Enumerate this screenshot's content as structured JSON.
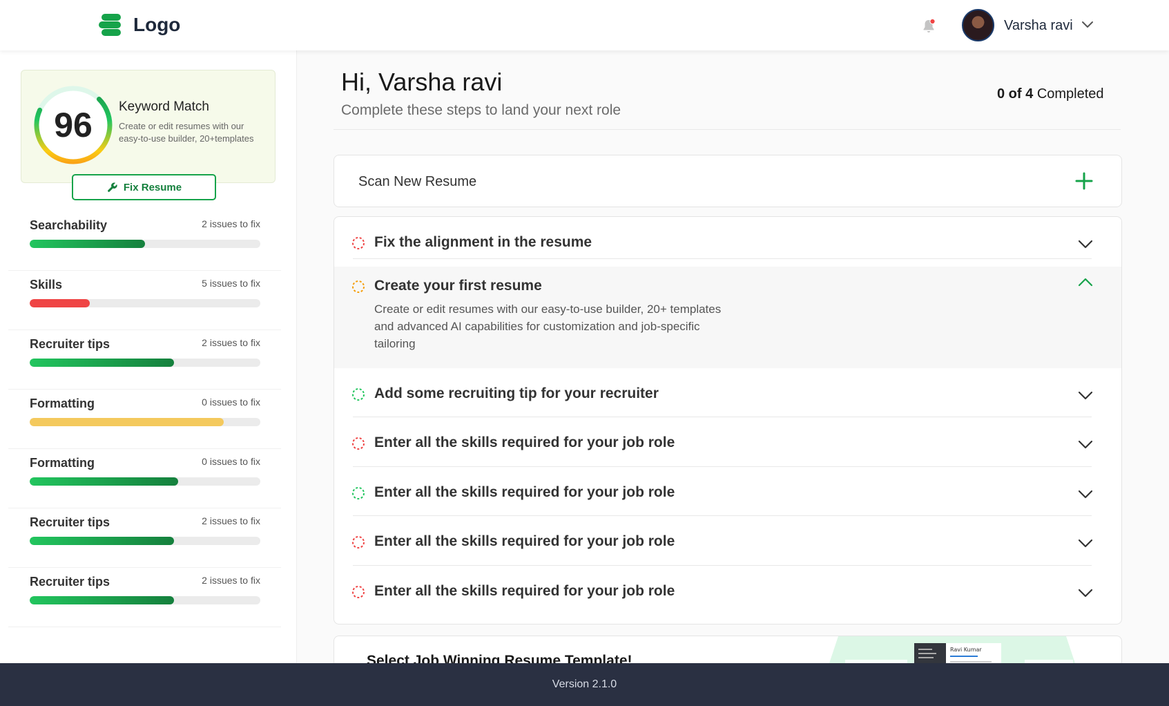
{
  "header": {
    "logo_text": "Logo",
    "user_name": "Varsha ravi"
  },
  "sidebar": {
    "keyword_match": {
      "score": "96",
      "score_value": 96,
      "title": "Keyword Match",
      "description": "Create or edit resumes with our easy-to-use builder, 20+templates"
    },
    "fix_button_label": "Fix Resume",
    "metrics": [
      {
        "label": "Searchability",
        "issues": "2 issues to fix",
        "progress": 0.5,
        "color": "#16a34a"
      },
      {
        "label": "Skills",
        "issues": "5 issues to fix",
        "progress": 0.26,
        "color": "#ef4444"
      },
      {
        "label": "Recruiter tips",
        "issues": "2 issues to fix",
        "progress": 0.625,
        "color": "#16a34a"
      },
      {
        "label": "Formatting",
        "issues": "0 issues to fix",
        "progress": 0.84,
        "color": "#f4c95d"
      },
      {
        "label": "Formatting",
        "issues": "0 issues to fix",
        "progress": 0.645,
        "color": "#16a34a"
      },
      {
        "label": "Recruiter tips",
        "issues": "2 issues to fix",
        "progress": 0.625,
        "color": "#16a34a"
      },
      {
        "label": "Recruiter tips",
        "issues": "2 issues to fix",
        "progress": 0.625,
        "color": "#16a34a"
      }
    ]
  },
  "main": {
    "greeting": "Hi, Varsha ravi",
    "subtitle": "Complete these steps to land your next role",
    "completed_count": "0 of 4",
    "completed_label": "Completed",
    "scan_label": "Scan New Resume",
    "tasks": [
      {
        "title": "Fix the alignment in the resume",
        "status_color": "#ef4444",
        "expanded": false
      },
      {
        "title": "Create your first resume",
        "status_color": "#f59e0b",
        "expanded": true,
        "description": "Create or edit resumes with our easy-to-use builder, 20+ templates and advanced AI capabilities for customization and job-specific tailoring"
      },
      {
        "title": "Add some recruiting tip for your recruiter",
        "status_color": "#22c55e",
        "expanded": false
      },
      {
        "title": "Enter all the skills required for your job role",
        "status_color": "#ef4444",
        "expanded": false
      },
      {
        "title": "Enter all the skills required for your job role",
        "status_color": "#22c55e",
        "expanded": false
      },
      {
        "title": "Enter all the skills required for your job role",
        "status_color": "#ef4444",
        "expanded": false
      },
      {
        "title": "Enter all the skills required for your job role",
        "status_color": "#ef4444",
        "expanded": false
      }
    ],
    "template_title": "Select Job Winning Resume Template!",
    "template_preview_name": "Ravi Kumar"
  },
  "footer": {
    "version": "Version 2.1.0"
  },
  "colors": {
    "brand": "#16a34a",
    "footer_bg": "#2a3042"
  }
}
